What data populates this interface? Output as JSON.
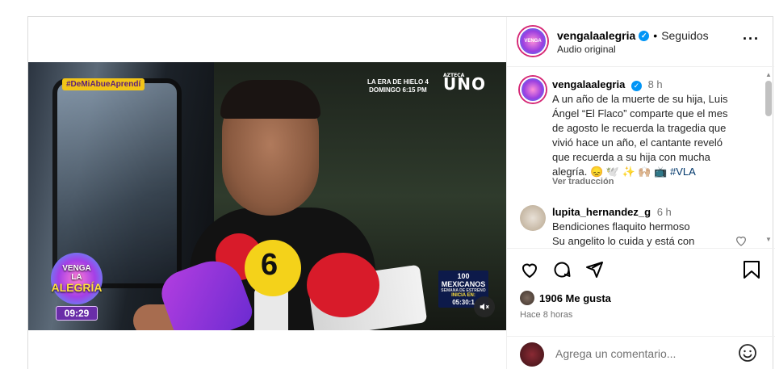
{
  "video": {
    "hashtag_tag": "#DeMiAbueAprendí",
    "promo_line1": "LA ERA DE HIELO 4",
    "promo_line2": "DOMINGO 6:15 PM",
    "channel_label": "UNO",
    "channel_small": "AZTECA",
    "show_logo_top": "VENGA",
    "show_logo_mid": "LA",
    "show_logo_bottom": "ALEGRÍA",
    "clock": "09:29",
    "mic_number": "6",
    "promo_box": {
      "line1": "100",
      "line2": "MEXICANOS",
      "line3": "SEMANA DE ESTRENO",
      "line4": "INICIA EN:",
      "line5": "05:30:1"
    }
  },
  "header": {
    "username": "vengalaalegria",
    "verified_mark": "✓",
    "separator": "•",
    "follow_status": "Seguidos",
    "subtitle": "Audio original",
    "more_icon": "···"
  },
  "caption": {
    "username": "vengalaalegria",
    "time": "8 h",
    "text": "A un año de la muerte de su hija, Luis Ángel “El Flaco” comparte que el mes de agosto le recuerda la tragedia que vivió hace un año, el cantante reveló que recuerda a su hija con mucha alegría. 😞 🕊️ ✨ 🙌🏼 📺",
    "hashtag": "#VLA",
    "see_translation": "Ver traducción"
  },
  "comment": {
    "username": "lupita_hernandez_g",
    "time": "6 h",
    "line1": "Bendiciones flaquito hermoso",
    "line2": "Su angelito lo cuida y está con"
  },
  "actions": {
    "likes": "1906 Me gusta",
    "posted": "Hace 8 horas"
  },
  "add_comment": {
    "placeholder": "Agrega un comentario..."
  },
  "colors": {
    "verified": "#0095f6",
    "hashtag": "#00376b",
    "muted_text": "#737373",
    "border": "#dbdbdb"
  },
  "icons": [
    "heart-icon",
    "comment-icon",
    "share-icon",
    "bookmark-icon",
    "emoji-icon",
    "mute-icon",
    "more-icon",
    "verified-icon"
  ]
}
